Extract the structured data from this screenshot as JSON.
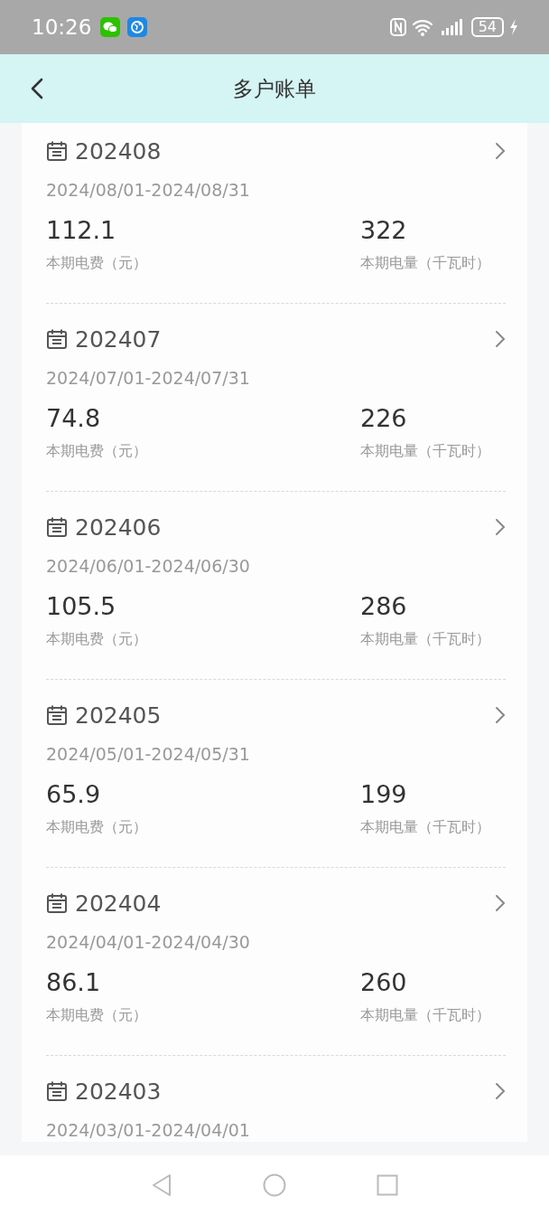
{
  "status_bar": {
    "time": "10:26",
    "battery": "54"
  },
  "header": {
    "title": "多户账单"
  },
  "bills": [
    {
      "month": "202408",
      "period": "2024/08/01-2024/08/31",
      "fee": "112.1",
      "fee_label": "本期电费（元）",
      "usage": "322",
      "usage_label": "本期电量（千瓦时）"
    },
    {
      "month": "202407",
      "period": "2024/07/01-2024/07/31",
      "fee": "74.8",
      "fee_label": "本期电费（元）",
      "usage": "226",
      "usage_label": "本期电量（千瓦时）"
    },
    {
      "month": "202406",
      "period": "2024/06/01-2024/06/30",
      "fee": "105.5",
      "fee_label": "本期电费（元）",
      "usage": "286",
      "usage_label": "本期电量（千瓦时）"
    },
    {
      "month": "202405",
      "period": "2024/05/01-2024/05/31",
      "fee": "65.9",
      "fee_label": "本期电费（元）",
      "usage": "199",
      "usage_label": "本期电量（千瓦时）"
    },
    {
      "month": "202404",
      "period": "2024/04/01-2024/04/30",
      "fee": "86.1",
      "fee_label": "本期电费（元）",
      "usage": "260",
      "usage_label": "本期电量（千瓦时）"
    },
    {
      "month": "202403",
      "period": "2024/03/01-2024/04/01"
    }
  ]
}
